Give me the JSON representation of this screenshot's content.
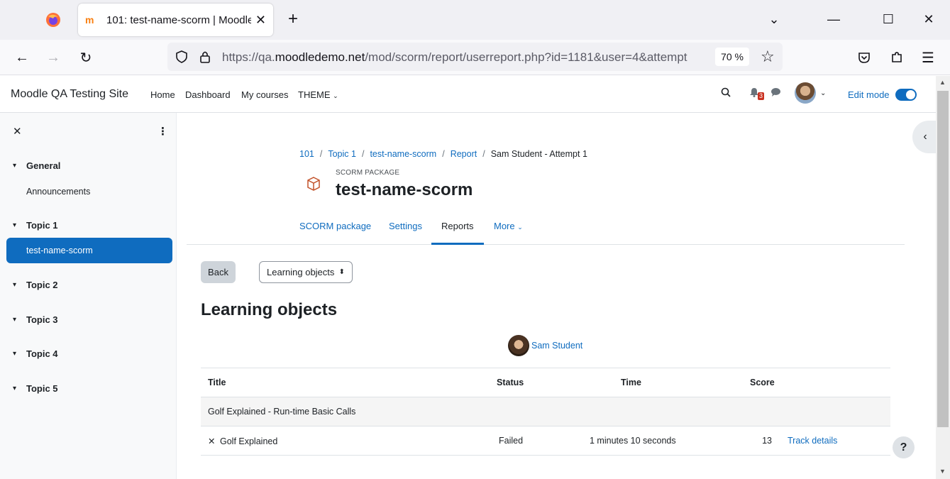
{
  "browser": {
    "tab_title": "101: test-name-scorm | Moodle",
    "favicon": "m",
    "new_tab": "+",
    "url_prefix": "https://qa.",
    "url_domain": "moodledemo.net",
    "url_path": "/mod/scorm/report/userreport.php?id=1181&user=4&attempt",
    "zoom": "70 %"
  },
  "moodle_nav": {
    "site_name": "Moodle QA Testing Site",
    "links": [
      "Home",
      "Dashboard",
      "My courses",
      "THEME"
    ],
    "notification_count": "3",
    "edit_mode_label": "Edit mode"
  },
  "drawer": {
    "sections": [
      {
        "label": "General",
        "items": [
          "Announcements"
        ]
      },
      {
        "label": "Topic 1",
        "items": [
          "test-name-scorm"
        ]
      },
      {
        "label": "Topic 2",
        "items": []
      },
      {
        "label": "Topic 3",
        "items": []
      },
      {
        "label": "Topic 4",
        "items": []
      },
      {
        "label": "Topic 5",
        "items": []
      }
    ],
    "active_item": "test-name-scorm"
  },
  "breadcrumb": [
    "101",
    "Topic 1",
    "test-name-scorm",
    "Report",
    "Sam Student - Attempt 1"
  ],
  "activity": {
    "type": "SCORM PACKAGE",
    "title": "test-name-scorm"
  },
  "tabs": [
    "SCORM package",
    "Settings",
    "Reports",
    "More"
  ],
  "active_tab": "Reports",
  "controls": {
    "back": "Back",
    "select_value": "Learning objects"
  },
  "heading": "Learning objects",
  "user": "Sam Student",
  "table": {
    "headers": [
      "Title",
      "Status",
      "Time",
      "Score",
      ""
    ],
    "group": "Golf Explained - Run-time Basic Calls",
    "rows": [
      {
        "title": "Golf Explained",
        "status": "Failed",
        "time": "1 minutes 10 seconds",
        "score": "13",
        "action": "Track details"
      }
    ]
  },
  "help": "?"
}
